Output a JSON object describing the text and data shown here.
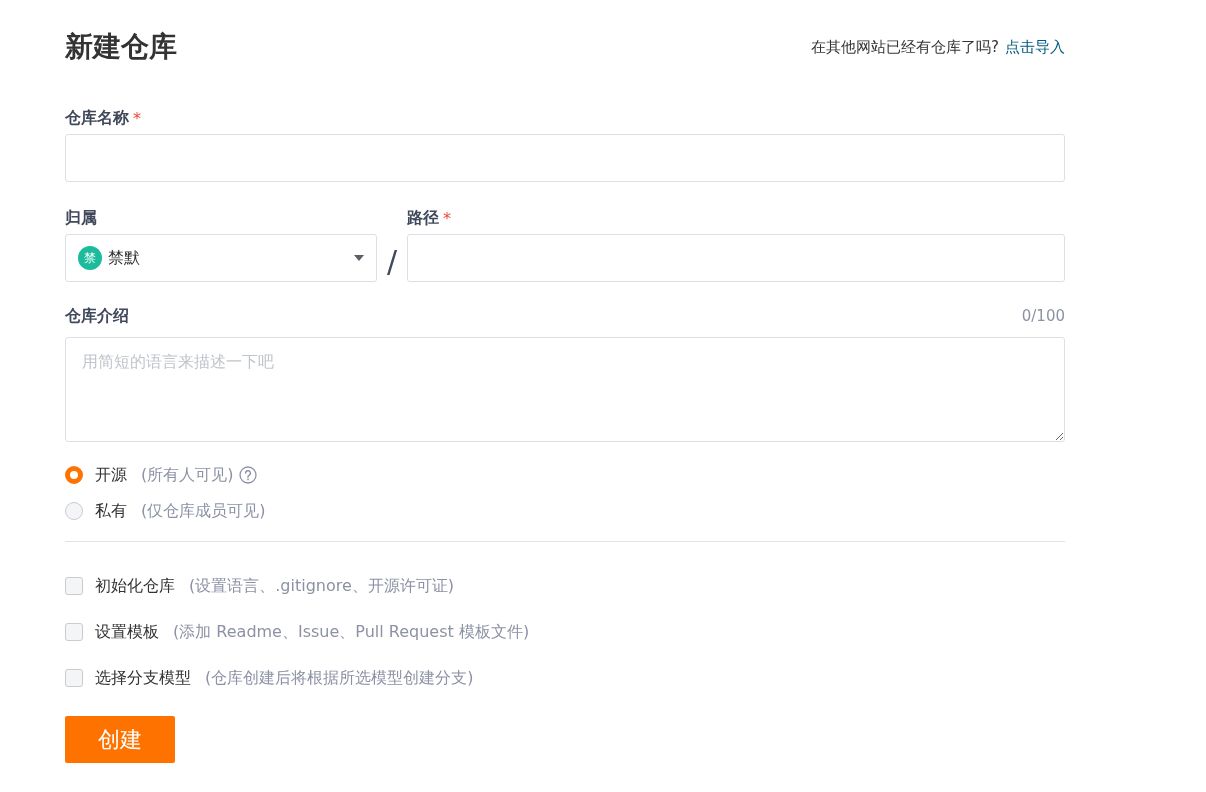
{
  "title": "新建仓库",
  "import": {
    "prompt": "在其他网站已经有仓库了吗?",
    "link": "点击导入"
  },
  "name_field": {
    "label": "仓库名称",
    "required_mark": "*"
  },
  "owner_field": {
    "label": "归属",
    "avatar_letter": "禁",
    "value": "禁默"
  },
  "separator": "/",
  "path_field": {
    "label": "路径",
    "required_mark": "*"
  },
  "description_field": {
    "label": "仓库介绍",
    "counter": "0/100",
    "placeholder": "用简短的语言来描述一下吧"
  },
  "visibility": [
    {
      "label": "开源",
      "hint": "(所有人可见)",
      "selected": true,
      "help": true
    },
    {
      "label": "私有",
      "hint": "(仅仓库成员可见)",
      "selected": false,
      "help": false
    }
  ],
  "options": [
    {
      "label": "初始化仓库",
      "hint": "(设置语言、.gitignore、开源许可证)",
      "checked": false
    },
    {
      "label": "设置模板",
      "hint": "(添加 Readme、Issue、Pull Request 模板文件)",
      "checked": false
    },
    {
      "label": "选择分支模型",
      "hint": "(仓库创建后将根据所选模型创建分支)",
      "checked": false
    }
  ],
  "submit": "创建"
}
